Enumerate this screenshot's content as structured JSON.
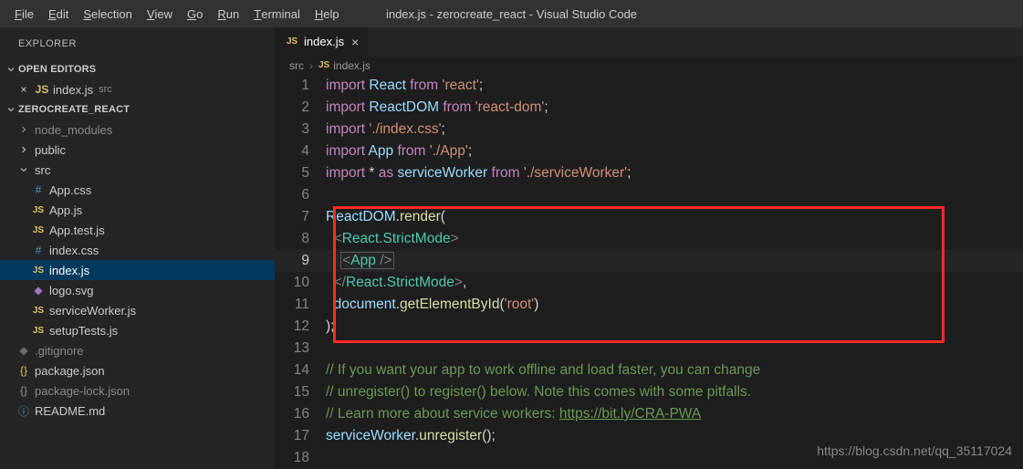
{
  "window": {
    "title": "index.js - zerocreate_react - Visual Studio Code"
  },
  "menu": [
    "File",
    "Edit",
    "Selection",
    "View",
    "Go",
    "Run",
    "Terminal",
    "Help"
  ],
  "explorer": {
    "title": "EXPLORER",
    "openEditors": {
      "label": "OPEN EDITORS",
      "items": [
        {
          "name": "index.js",
          "dir": "src"
        }
      ]
    },
    "project": {
      "label": "ZEROCREATE_REACT",
      "folders": [
        {
          "name": "node_modules",
          "expanded": false,
          "dim": true
        },
        {
          "name": "public",
          "expanded": false
        },
        {
          "name": "src",
          "expanded": true
        }
      ],
      "srcFiles": [
        {
          "name": "App.css",
          "kind": "css"
        },
        {
          "name": "App.js",
          "kind": "js"
        },
        {
          "name": "App.test.js",
          "kind": "js"
        },
        {
          "name": "index.css",
          "kind": "css"
        },
        {
          "name": "index.js",
          "kind": "js",
          "selected": true
        },
        {
          "name": "logo.svg",
          "kind": "svg"
        },
        {
          "name": "serviceWorker.js",
          "kind": "js"
        },
        {
          "name": "setupTests.js",
          "kind": "js"
        }
      ],
      "rootFiles": [
        {
          "name": ".gitignore",
          "kind": "git",
          "dim": true
        },
        {
          "name": "package.json",
          "kind": "json"
        },
        {
          "name": "package-lock.json",
          "kind": "json",
          "dim": true
        },
        {
          "name": "README.md",
          "kind": "info"
        }
      ]
    }
  },
  "editor": {
    "tab": {
      "name": "index.js"
    },
    "breadcrumb": {
      "folder": "src",
      "file": "index.js"
    },
    "lines": [
      {
        "n": 1,
        "tokens": [
          [
            "kw",
            "import"
          ],
          [
            "sp",
            " "
          ],
          [
            "var",
            "React"
          ],
          [
            "sp",
            " "
          ],
          [
            "kw",
            "from"
          ],
          [
            "sp",
            " "
          ],
          [
            "str",
            "'react'"
          ],
          [
            "op",
            ";"
          ]
        ]
      },
      {
        "n": 2,
        "tokens": [
          [
            "kw",
            "import"
          ],
          [
            "sp",
            " "
          ],
          [
            "var",
            "ReactDOM"
          ],
          [
            "sp",
            " "
          ],
          [
            "kw",
            "from"
          ],
          [
            "sp",
            " "
          ],
          [
            "str",
            "'react-dom'"
          ],
          [
            "op",
            ";"
          ]
        ]
      },
      {
        "n": 3,
        "tokens": [
          [
            "kw",
            "import"
          ],
          [
            "sp",
            " "
          ],
          [
            "str",
            "'./index.css'"
          ],
          [
            "op",
            ";"
          ]
        ]
      },
      {
        "n": 4,
        "tokens": [
          [
            "kw",
            "import"
          ],
          [
            "sp",
            " "
          ],
          [
            "var",
            "App"
          ],
          [
            "sp",
            " "
          ],
          [
            "kw",
            "from"
          ],
          [
            "sp",
            " "
          ],
          [
            "str",
            "'./App'"
          ],
          [
            "op",
            ";"
          ]
        ]
      },
      {
        "n": 5,
        "tokens": [
          [
            "kw",
            "import"
          ],
          [
            "sp",
            " "
          ],
          [
            "op",
            "*"
          ],
          [
            "sp",
            " "
          ],
          [
            "kw",
            "as"
          ],
          [
            "sp",
            " "
          ],
          [
            "var",
            "serviceWorker"
          ],
          [
            "sp",
            " "
          ],
          [
            "kw",
            "from"
          ],
          [
            "sp",
            " "
          ],
          [
            "str",
            "'./serviceWorker'"
          ],
          [
            "op",
            ";"
          ]
        ]
      },
      {
        "n": 6,
        "tokens": []
      },
      {
        "n": 7,
        "tokens": [
          [
            "var",
            "ReactDOM"
          ],
          [
            "op",
            "."
          ],
          [
            "fn",
            "render"
          ],
          [
            "op",
            "("
          ]
        ]
      },
      {
        "n": 8,
        "tokens": [
          [
            "sp",
            "  "
          ],
          [
            "punc",
            "<"
          ],
          [
            "type",
            "React.StrictMode"
          ],
          [
            "punc",
            ">"
          ]
        ]
      },
      {
        "n": 9,
        "active": true,
        "tokens": [
          [
            "sp",
            "    "
          ],
          [
            "caret-open",
            ""
          ],
          [
            "punc",
            "<"
          ],
          [
            "type",
            "App"
          ],
          [
            "sp",
            " "
          ],
          [
            "punc",
            "/>"
          ],
          [
            "caret-close",
            ""
          ]
        ]
      },
      {
        "n": 10,
        "tokens": [
          [
            "sp",
            "  "
          ],
          [
            "punc",
            "</"
          ],
          [
            "type",
            "React.StrictMode"
          ],
          [
            "punc",
            ">"
          ],
          [
            "op",
            ","
          ]
        ]
      },
      {
        "n": 11,
        "tokens": [
          [
            "sp",
            "  "
          ],
          [
            "var",
            "document"
          ],
          [
            "op",
            "."
          ],
          [
            "fn",
            "getElementById"
          ],
          [
            "op",
            "("
          ],
          [
            "str",
            "'root'"
          ],
          [
            "op",
            ")"
          ]
        ]
      },
      {
        "n": 12,
        "tokens": [
          [
            "op",
            ");"
          ]
        ]
      },
      {
        "n": 13,
        "tokens": []
      },
      {
        "n": 14,
        "tokens": [
          [
            "cmt",
            "// If you want your app to work offline and load faster, you can change"
          ]
        ]
      },
      {
        "n": 15,
        "tokens": [
          [
            "cmt",
            "// unregister() to register() below. Note this comes with some pitfalls."
          ]
        ]
      },
      {
        "n": 16,
        "tokens": [
          [
            "cmt",
            "// Learn more about service workers: "
          ],
          [
            "link",
            "https://bit.ly/CRA-PWA"
          ]
        ]
      },
      {
        "n": 17,
        "tokens": [
          [
            "var",
            "serviceWorker"
          ],
          [
            "op",
            "."
          ],
          [
            "fn",
            "unregister"
          ],
          [
            "op",
            "();"
          ]
        ]
      },
      {
        "n": 18,
        "tokens": []
      }
    ]
  },
  "watermark": "https://blog.csdn.net/qq_35117024"
}
